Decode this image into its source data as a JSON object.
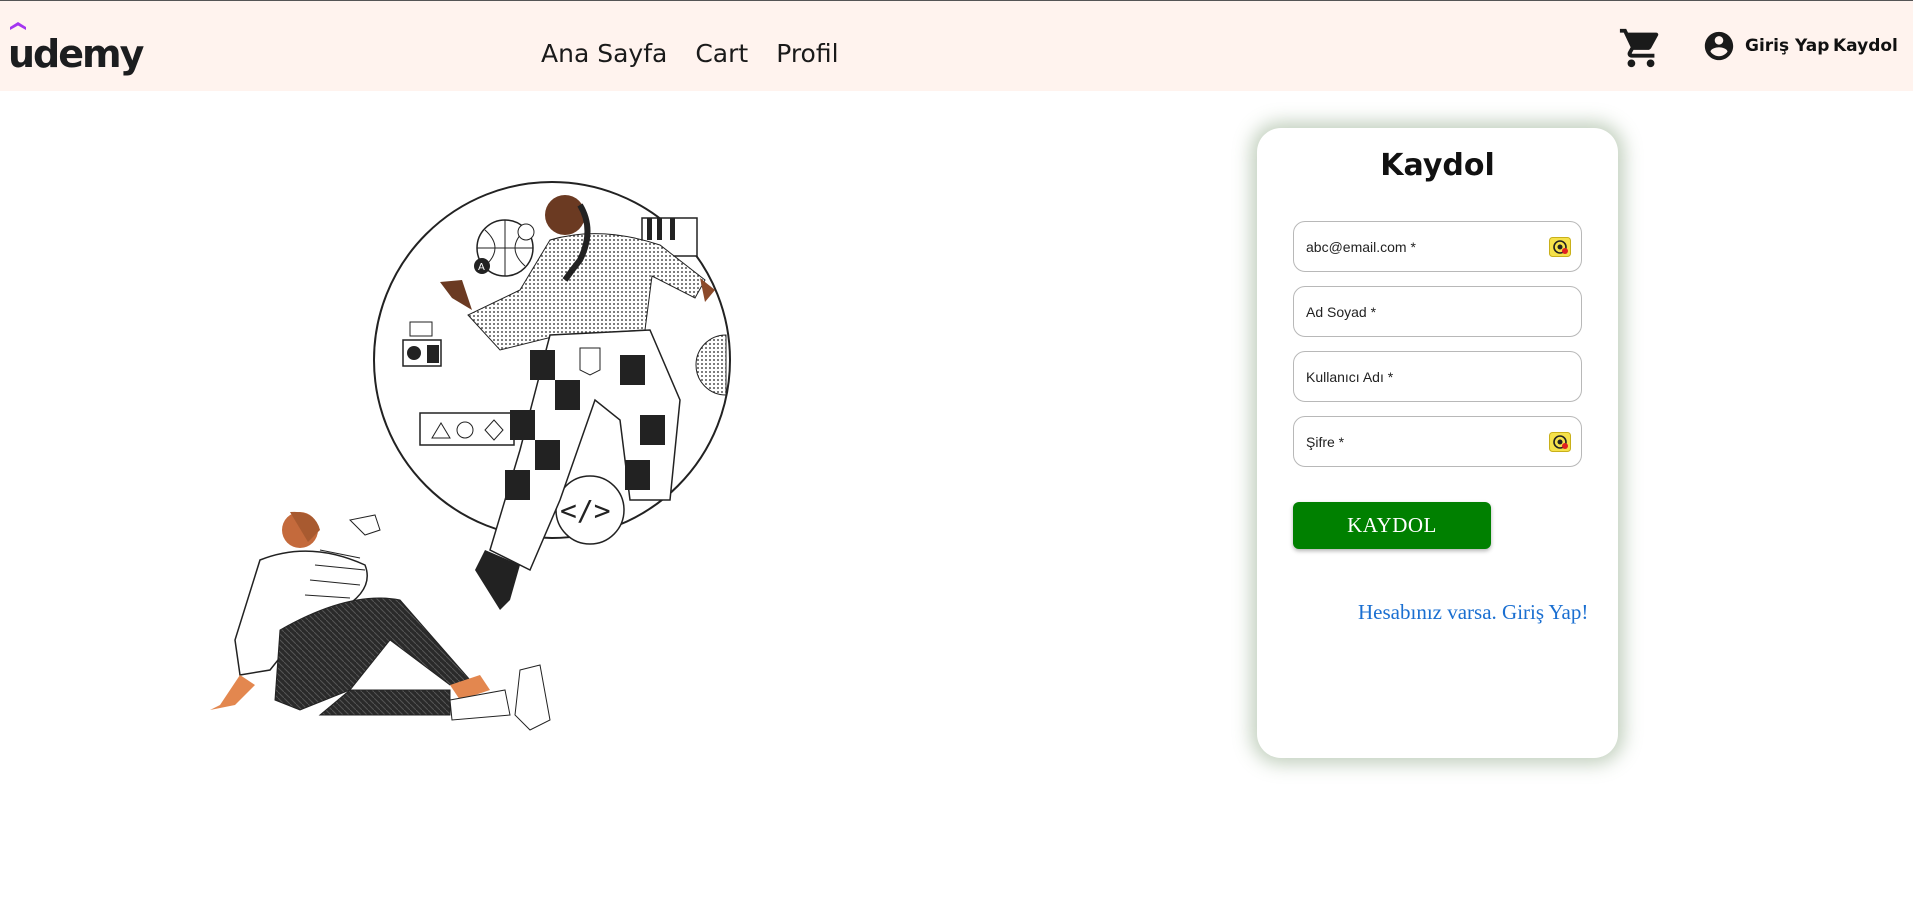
{
  "header": {
    "logo_text": "udemy",
    "nav": [
      "Ana Sayfa",
      "Cart",
      "Profil"
    ],
    "login_label": "Giriş Yap",
    "signup_label": "Kaydol",
    "icons": {
      "cart": "cart-icon",
      "account": "account-circle-icon"
    },
    "brand_color": "#a435f0"
  },
  "form": {
    "title": "Kaydol",
    "fields": {
      "email": {
        "placeholder": "abc@email.com *"
      },
      "fullname": {
        "placeholder": "Ad Soyad *"
      },
      "username": {
        "placeholder": "Kullanıcı Adı *"
      },
      "password": {
        "placeholder": "Şifre *"
      }
    },
    "submit_label": "KAYDOL",
    "login_link": "Hesabınız varsa. Giriş Yap!",
    "accent_color": "#008000"
  }
}
